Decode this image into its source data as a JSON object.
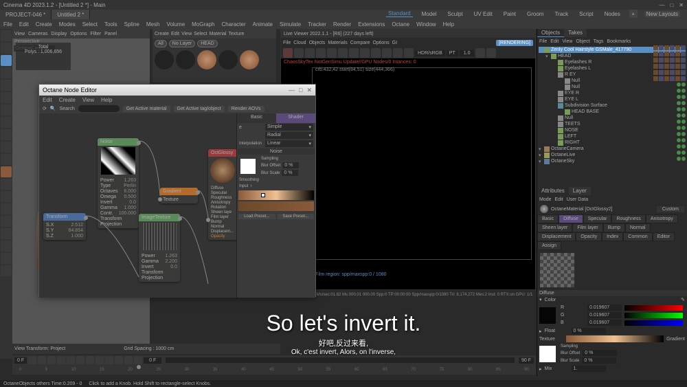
{
  "app": {
    "title": "Cinema 4D 2023.1.2 - [Untitled 2 *] - Main",
    "tabs": [
      "PROJECT-046 *",
      "Untitled 2 *"
    ],
    "menu": [
      "File",
      "Edit",
      "Create",
      "Modes",
      "Select",
      "Tools",
      "Spline",
      "Mesh",
      "Volume",
      "MoGraph",
      "Character",
      "Animate",
      "Simulate",
      "Tracker",
      "Render",
      "Extensions",
      "Octane",
      "Window",
      "Help"
    ],
    "topmenus": [
      "Standard",
      "Model",
      "Sculpt",
      "UV Edit",
      "Paint",
      "Groom",
      "Track",
      "Script",
      "Nodes"
    ],
    "newlayouts": "New Layouts"
  },
  "viewport": {
    "menu": [
      "View",
      "Cameras",
      "Display",
      "Options",
      "Filter",
      "Panel"
    ],
    "label": "Perspective",
    "camera": "OctaneCamera",
    "info": {
      "total": "Total",
      "polys": "Polys : 1,006,656"
    },
    "footer_left": "View Transform: Project",
    "footer_grid": "Grid Spacing : 1000 cm"
  },
  "matpanel": {
    "menu": [
      "Create",
      "Edit",
      "View",
      "Select",
      "Material",
      "Texture"
    ],
    "filters": [
      "All",
      "No Layer",
      "HEAD"
    ]
  },
  "liveviewer": {
    "title": "Live Viewer 2022.1.1 - [R6] (227 days left)",
    "menu": [
      "File",
      "Cloud",
      "Objects",
      "Materials",
      "Compare",
      "Options",
      "GI"
    ],
    "rendering": "[RENDERING]",
    "hdr": "HDR/sRGB",
    "pt": "PT",
    "redtext": "ChaosSkyTex NotGenSimu Update//GPU Nodes/0 Intances: 0",
    "renderlabel": "crb:432,42 start(84,51) size(444,366)",
    "status": "Film region: spp/maxspp:0 / 1080",
    "progress": "Rendering: 0.00%   Ms/sec:01.82   Ms:000.01 000.00   Spp:0   TP:00:00:00   Spp/maxspp:0/1080   Tri: 8,174,272 Mes:2   Inst: 0   RTX:on   GPU: 1/1"
  },
  "nodeeditor": {
    "title": "Octane Node Editor",
    "menu": [
      "Edit",
      "Create",
      "View",
      "Help"
    ],
    "search": "Search",
    "buttons": [
      "Get Active material",
      "Get Active tag/object",
      "Render AOVs"
    ],
    "tabs": [
      "Basic",
      "Shader"
    ],
    "panel": {
      "simple": "Simple",
      "radial": "Radial",
      "interp_label": "Interpolation",
      "interp_val": "Linear",
      "noise_label": "Noise",
      "sampling": "Sampling",
      "blur_offset_label": "Blur Offset",
      "blur_offset_val": "0 %",
      "blur_scale_label": "Blur Scale",
      "blur_scale_val": "0 %",
      "smoothing": "Smoothing",
      "input_label": "Input",
      "load_preset": "Load Preset...",
      "save_preset": "Save Preset..."
    },
    "nodes": {
      "noise": {
        "title": "Noise",
        "params": [
          [
            "Power",
            "1.263"
          ],
          [
            "Type",
            "Perlin"
          ],
          [
            "Octaves",
            "6.000"
          ],
          [
            "Omega",
            "0.500"
          ],
          [
            "Invert",
            "0.0"
          ],
          [
            "Gamma",
            "1.000"
          ],
          [
            "Contr.",
            "100.000"
          ],
          [
            "Transform",
            ""
          ],
          [
            "Projection",
            ""
          ]
        ]
      },
      "gradient": {
        "title": "Gradient",
        "sub": "Texture"
      },
      "imgtex": {
        "title": "ImageTexture",
        "params": [
          [
            "Power",
            "1.263"
          ],
          [
            "Gamma",
            "2.200"
          ],
          [
            "Invert",
            "0.0"
          ],
          [
            "Transform",
            ""
          ],
          [
            "Projection",
            ""
          ]
        ]
      },
      "transform": {
        "title": "Transform",
        "params": [
          [
            "S.X",
            "2.512"
          ],
          [
            "S.Y",
            "64.854"
          ],
          [
            "S.Z",
            "1.000"
          ]
        ]
      },
      "octmat": {
        "title": "OctGlossy",
        "params": [
          "Diffuse",
          "Specular",
          "Roughness",
          "Anisotropy",
          "Rotation",
          "Sheen laye",
          "Film layer",
          "Bump",
          "Normal",
          "Displacem...",
          "Opacity"
        ]
      }
    }
  },
  "hierarchy": {
    "tabs": [
      "Objects",
      "Takes"
    ],
    "menu": [
      "File",
      "Edit",
      "View",
      "Object",
      "Tags",
      "Bookmarks"
    ],
    "items": [
      {
        "name": "Zenly Cool Hairstyle GSMale_417790",
        "depth": 0,
        "icon": "poly",
        "sel": true
      },
      {
        "name": "HEAD",
        "depth": 1,
        "icon": "poly"
      },
      {
        "name": "Eyelashes R",
        "depth": 2,
        "icon": "poly"
      },
      {
        "name": "Eyelashes L",
        "depth": 2,
        "icon": "poly"
      },
      {
        "name": "R EY",
        "depth": 2,
        "icon": "null"
      },
      {
        "name": "Null",
        "depth": 3,
        "icon": "null"
      },
      {
        "name": "Null",
        "depth": 3,
        "icon": "null"
      },
      {
        "name": "EYE R",
        "depth": 2,
        "icon": "null"
      },
      {
        "name": "EYE L",
        "depth": 2,
        "icon": "null"
      },
      {
        "name": "Subdivision Surface",
        "depth": 2,
        "icon": "sds"
      },
      {
        "name": "HEAD BASE",
        "depth": 3,
        "icon": "poly"
      },
      {
        "name": "Null",
        "depth": 2,
        "icon": "null"
      },
      {
        "name": "TEETS",
        "depth": 2,
        "icon": "null"
      },
      {
        "name": "NOSE",
        "depth": 2,
        "icon": "poly"
      },
      {
        "name": "LEFT",
        "depth": 2,
        "icon": "poly"
      },
      {
        "name": "RIGHT",
        "depth": 2,
        "icon": "poly"
      },
      {
        "name": "OctaneCamera",
        "depth": 0,
        "icon": "cam"
      },
      {
        "name": "OctaneLive",
        "depth": 0,
        "icon": "light"
      },
      {
        "name": "OctaneSky",
        "depth": 0,
        "icon": "sky"
      }
    ]
  },
  "attributes": {
    "tabs": [
      "Attributes",
      "Layer"
    ],
    "menu": [
      "Mode",
      "Edit",
      "User Data"
    ],
    "matname": "OctaneMaterial [OctGlossy2]",
    "custom": "Custom",
    "tabgrid": [
      "Basic",
      "Diffuse",
      "Specular",
      "Roughness",
      "Anisotropy",
      "Sheen layer",
      "Film layer",
      "Bump",
      "Normal",
      "Displacement",
      "Opacity",
      "Index",
      "Common",
      "Editor",
      "Assign"
    ],
    "diffuse": "Diffuse",
    "color": "Color",
    "rgb": {
      "r": "0.019607",
      "g": "0.019607",
      "b": "0.019607"
    },
    "float": "Float",
    "float_val": "0 %",
    "texture": "Texture",
    "gradient": "Gradient",
    "sampling": "Sampling",
    "blur_offset": "Blur Offset",
    "blur_offset_val": "0 %",
    "blur_scale": "Blur Scale",
    "blur_scale_val": "0 %",
    "mix": "Mix",
    "mix_val": "1."
  },
  "timeline": {
    "frame": "0 F",
    "start": "0 F",
    "end": "90 F",
    "ticks": [
      "0",
      "5",
      "10",
      "15",
      "20",
      "25",
      "30",
      "35",
      "40",
      "45",
      "50",
      "55",
      "60",
      "65",
      "70",
      "75",
      "80",
      "85",
      "90"
    ]
  },
  "statusbar": {
    "left": "OctaneObjects others Time:0.209 - 0",
    "hint": "Click to add a Knob. Hold Shift to rectangle-select Knobs."
  },
  "subtitles": {
    "main": "So let's invert it.",
    "cn": "好吧,反过来看,",
    "fr": "Ok, c'est invert, Alors, on l'inverse,"
  }
}
